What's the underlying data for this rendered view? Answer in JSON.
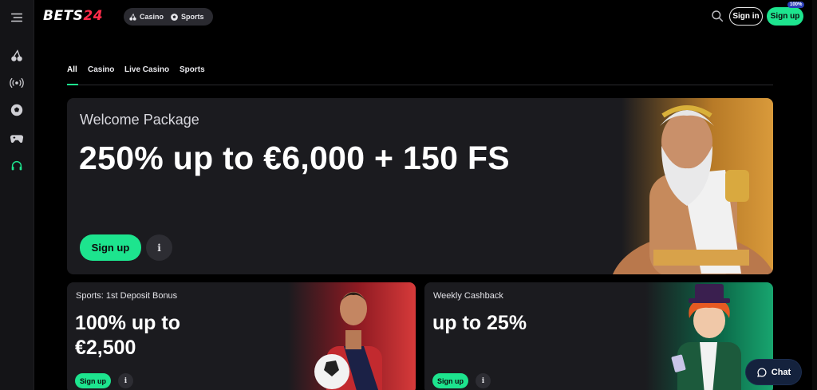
{
  "header": {
    "logo_prefix": "BETS",
    "logo_number": "24",
    "mode_casino": "Casino",
    "mode_sports": "Sports",
    "sign_in": "Sign in",
    "sign_up": "Sign up",
    "badge": "100%"
  },
  "sidebar": {
    "icons": [
      "menu-icon",
      "casino-cherries-icon",
      "live-broadcast-icon",
      "sports-ball-icon",
      "gamepad-icon",
      "support-headset-icon"
    ]
  },
  "tabs": [
    {
      "label": "All",
      "active": true
    },
    {
      "label": "Casino",
      "active": false
    },
    {
      "label": "Live Casino",
      "active": false
    },
    {
      "label": "Sports",
      "active": false
    }
  ],
  "hero": {
    "subtitle": "Welcome Package",
    "title": "250% up to €6,000 + 150 FS",
    "cta": "Sign up",
    "info": "i"
  },
  "cards": [
    {
      "subtitle": "Sports: 1st Deposit Bonus",
      "title_line1": "100% up to",
      "title_line2": "€2,500",
      "cta": "Sign up",
      "info": "i"
    },
    {
      "subtitle": "Weekly Cashback",
      "title_line1": "up to 25%",
      "title_line2": "",
      "cta": "Sign up",
      "info": "i"
    }
  ],
  "chat": {
    "label": "Chat"
  },
  "colors": {
    "accent": "#1de48e",
    "logo_red": "#ff2b4a",
    "panel": "#1b1b1f"
  }
}
